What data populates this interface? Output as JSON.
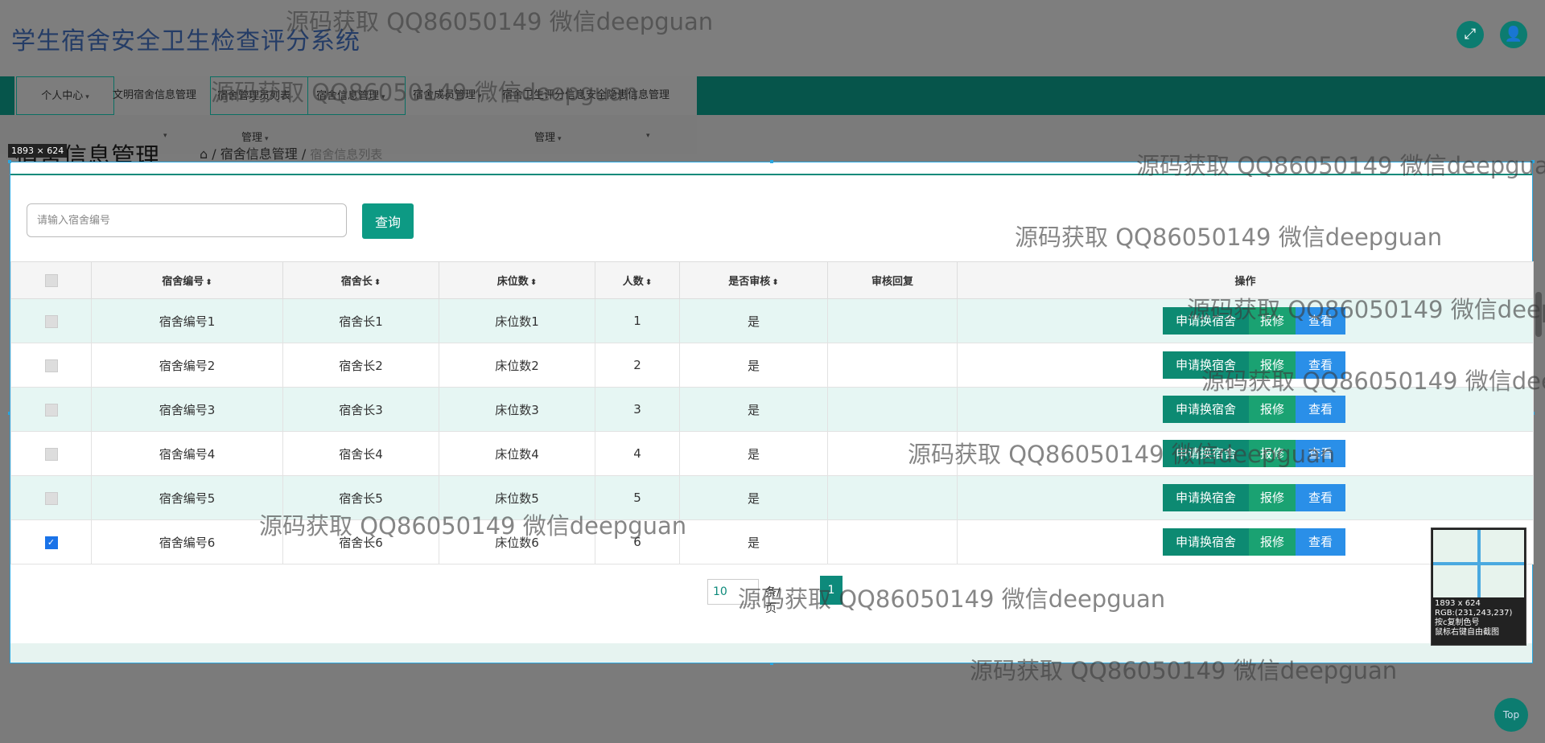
{
  "app": {
    "title": "学生宿舍安全卫生检查评分系统"
  },
  "header_icons": {
    "fullscreen": "fullscreen-icon",
    "user": "user-icon"
  },
  "nav": {
    "items": [
      {
        "label": "个人中心"
      },
      {
        "label": "文明宿舍信息管理"
      },
      {
        "label": "宿舍管理员列表"
      },
      {
        "label": "宿舍信息管理"
      },
      {
        "label": "宿舍成员管理"
      },
      {
        "label": "宿舍卫生评分信息"
      },
      {
        "label": "安全隐患信息管理"
      }
    ],
    "sub_items": [
      {
        "label": "管理"
      },
      {
        "label": "管理"
      }
    ]
  },
  "breadcrumb": {
    "heading": "宿舍信息管理",
    "path": "宿舍信息管理",
    "current": "宿舍信息列表"
  },
  "selection": {
    "dim_label": "1893 × 624"
  },
  "search": {
    "placeholder": "请输入宿舍编号",
    "button": "查询"
  },
  "table": {
    "headers": [
      "宿舍编号",
      "宿舍长",
      "床位数",
      "人数",
      "是否审核",
      "审核回复",
      "操作"
    ],
    "sortable": [
      true,
      true,
      true,
      true,
      true,
      false,
      false
    ],
    "rows": [
      {
        "id": "宿舍编号1",
        "leader": "宿舍长1",
        "beds": "床位数1",
        "people": "1",
        "audited": "是",
        "reply": "",
        "checked": false
      },
      {
        "id": "宿舍编号2",
        "leader": "宿舍长2",
        "beds": "床位数2",
        "people": "2",
        "audited": "是",
        "reply": "",
        "checked": false
      },
      {
        "id": "宿舍编号3",
        "leader": "宿舍长3",
        "beds": "床位数3",
        "people": "3",
        "audited": "是",
        "reply": "",
        "checked": false
      },
      {
        "id": "宿舍编号4",
        "leader": "宿舍长4",
        "beds": "床位数4",
        "people": "4",
        "audited": "是",
        "reply": "",
        "checked": false
      },
      {
        "id": "宿舍编号5",
        "leader": "宿舍长5",
        "beds": "床位数5",
        "people": "5",
        "audited": "是",
        "reply": "",
        "checked": false
      },
      {
        "id": "宿舍编号6",
        "leader": "宿舍长6",
        "beds": "床位数6",
        "people": "6",
        "audited": "是",
        "reply": "",
        "checked": true
      }
    ],
    "actions": {
      "apply": "申请换宿舍",
      "repair": "报修",
      "view": "查看"
    }
  },
  "pager": {
    "page_size": "10",
    "page_text": "条/页",
    "current_page": "1"
  },
  "magnifier": {
    "text": "1893 x 624\nRGB:(231,243,237)\n按c复制色号\n鼠标右键自由截图"
  },
  "watermark": "源码获取 QQ86050149 微信deepguan",
  "top_button": "Top",
  "colors": {
    "primary": "#0d8a7b",
    "dark_nav": "#06554b",
    "view_btn": "#2a8fe8",
    "row_alt": "#e6f6f3"
  }
}
